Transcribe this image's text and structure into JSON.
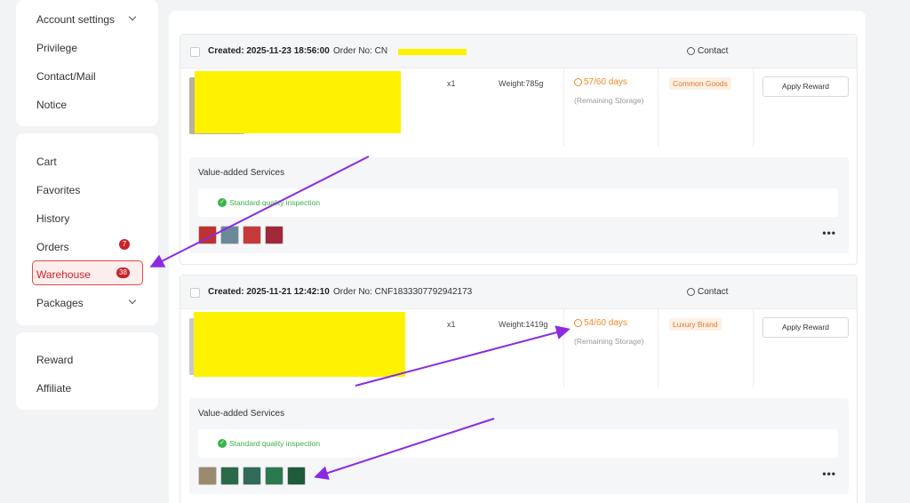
{
  "sidebar": {
    "group1": [
      {
        "label": "Account settings",
        "chevron": true
      },
      {
        "label": "Privilege"
      },
      {
        "label": "Contact/Mail"
      },
      {
        "label": "Notice"
      }
    ],
    "group2": [
      {
        "label": "Cart"
      },
      {
        "label": "Favorites"
      },
      {
        "label": "History"
      },
      {
        "label": "Orders",
        "badge": "7"
      },
      {
        "label": "Warehouse",
        "badge": "38",
        "active": true
      },
      {
        "label": "Packages",
        "chevron": true
      }
    ],
    "group3": [
      {
        "label": "Reward"
      },
      {
        "label": "Affiliate"
      }
    ]
  },
  "orders": [
    {
      "created": "Created: 2025-11-23 18:56:00",
      "order_no": "Order No: CN",
      "contact": "Contact",
      "qty": "x1",
      "weight": "Weight:785g",
      "days": "57/60 days",
      "remaining": "(Remaining Storage)",
      "tag": "Common Goods",
      "reward_label": "Apply Reward",
      "vas_title": "Value-added Services",
      "vas_item": "Standard quality inspection",
      "photo_colors": [
        "#c03030",
        "#6a8a9a",
        "#c83a3a",
        "#a02838"
      ]
    },
    {
      "created": "Created: 2025-11-21 12:42:10",
      "order_no": "Order No: CNF1833307792942173",
      "contact": "Contact",
      "qty": "x1",
      "weight": "Weight:1419g",
      "days": "54/60 days",
      "remaining": "(Remaining Storage)",
      "tag": "Luxury Brand",
      "reward_label": "Apply Reward",
      "vas_title": "Value-added Services",
      "vas_item": "Standard quality inspection",
      "photo_colors": [
        "#9a8a70",
        "#2a6a4a",
        "#2f6a5a",
        "#2a7a50",
        "#1f5a3a"
      ]
    }
  ],
  "colors": {
    "accent": "#c8232c",
    "storage": "#ee8a25",
    "ok": "#3bb34a",
    "annotation_arrow": "#8a2be2",
    "redaction": "#fff200"
  }
}
